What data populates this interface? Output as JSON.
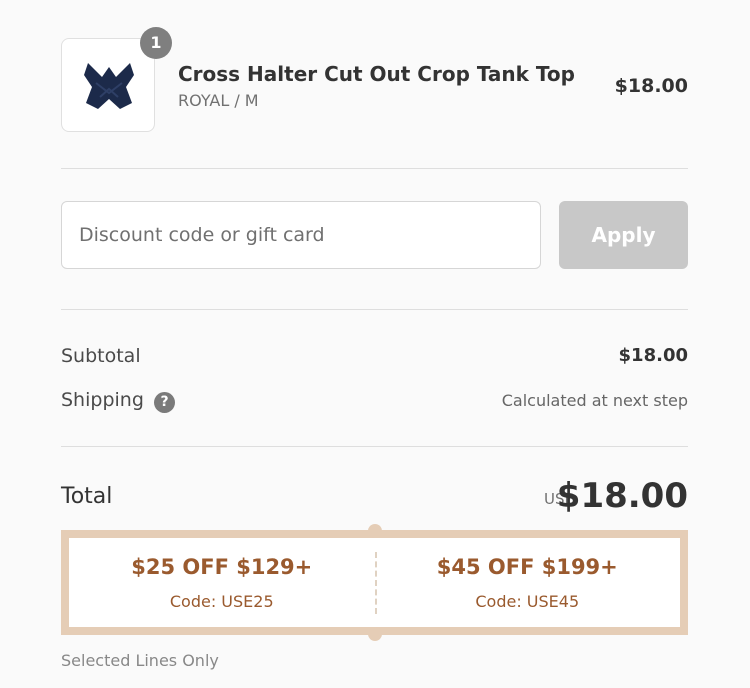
{
  "product": {
    "quantity": "1",
    "name": "Cross Halter Cut Out Crop Tank Top",
    "variant": "ROYAL / M",
    "price": "$18.00"
  },
  "discount": {
    "placeholder": "Discount code or gift card",
    "value": "",
    "apply_label": "Apply"
  },
  "summary": {
    "subtotal_label": "Subtotal",
    "subtotal_value": "$18.00",
    "shipping_label": "Shipping",
    "shipping_help_icon": "?",
    "shipping_value": "Calculated at next step",
    "total_label": "Total",
    "currency": "USD",
    "total_value": "$18.00"
  },
  "coupons": [
    {
      "title": "$25 OFF $129+",
      "code": "Code: USE25"
    },
    {
      "title": "$45 OFF $199+",
      "code": "Code: USE45"
    }
  ],
  "coupon_note": "Selected Lines Only",
  "colors": {
    "apply_disabled": "#c8c8c8",
    "coupon_border": "#e5cdb6",
    "coupon_text": "#9a5a2e",
    "product_color": "#1c2a4a"
  },
  "icons": {
    "help": "question-circle-icon",
    "product": "product-thumbnail"
  }
}
